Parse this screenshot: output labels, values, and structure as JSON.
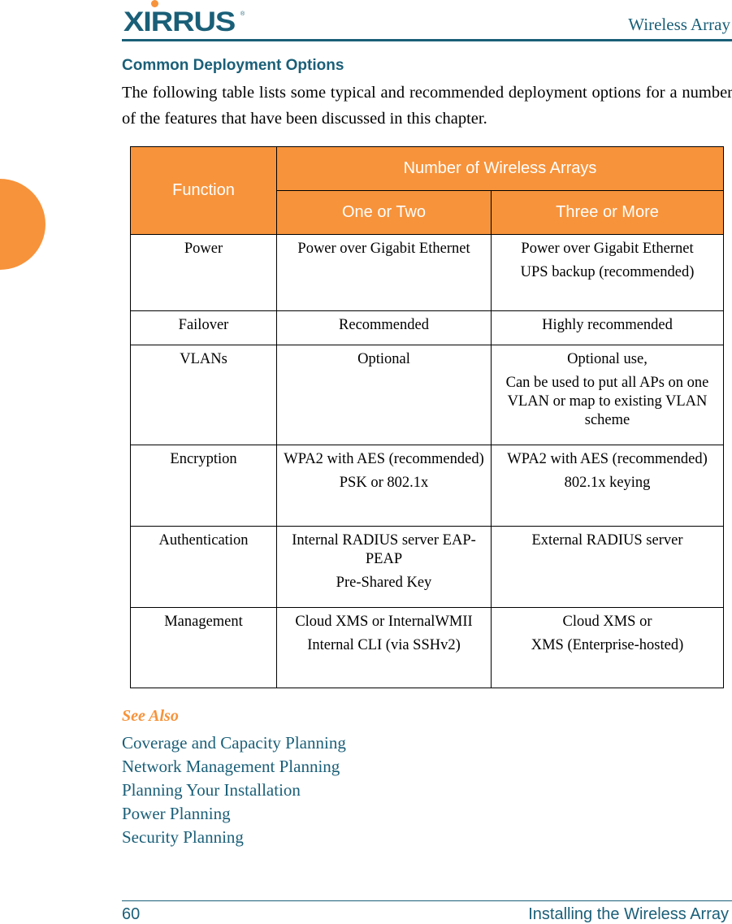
{
  "header": {
    "logo_text": "XIRRUS",
    "logo_reg": "®",
    "title": "Wireless Array"
  },
  "section": {
    "title": "Common Deployment Options",
    "intro": "The following table lists some typical and recommended deployment options for a number of the features that have been discussed in this chapter."
  },
  "table": {
    "header": {
      "function": "Function",
      "group": "Number of Wireless Arrays",
      "col1": "One or Two",
      "col2": "Three or More"
    },
    "rows": [
      {
        "function": "Power",
        "one_or_two": [
          "Power over Gigabit Ethernet"
        ],
        "three_or_more": [
          "Power over Gigabit Ethernet",
          "UPS backup (recommended)"
        ]
      },
      {
        "function": "Failover",
        "one_or_two": [
          "Recommended"
        ],
        "three_or_more": [
          "Highly recommended"
        ]
      },
      {
        "function": "VLANs",
        "one_or_two": [
          "Optional"
        ],
        "three_or_more": [
          "Optional use,",
          "Can be used to put all APs on one VLAN or map to existing VLAN scheme"
        ]
      },
      {
        "function": "Encryption",
        "one_or_two": [
          "WPA2 with AES (recommended)",
          "PSK or 802.1x"
        ],
        "three_or_more": [
          "WPA2 with AES (recommended)",
          "802.1x keying"
        ]
      },
      {
        "function": "Authentication",
        "one_or_two": [
          "Internal RADIUS server EAP-PEAP",
          "Pre-Shared Key"
        ],
        "three_or_more": [
          "External RADIUS server"
        ]
      },
      {
        "function": "Management",
        "one_or_two": [
          "Cloud XMS or InternalWMII",
          "Internal CLI (via SSHv2)"
        ],
        "three_or_more": [
          "Cloud XMS or",
          "XMS (Enterprise-hosted)"
        ]
      }
    ]
  },
  "see_also": {
    "title": "See Also",
    "links": [
      "Coverage and Capacity Planning",
      "Network Management Planning",
      "Planning Your Installation",
      "Power Planning",
      "Security Planning"
    ]
  },
  "footer": {
    "page_number": "60",
    "chapter": "Installing the Wireless Array"
  },
  "colors": {
    "brand_blue": "#1a5f78",
    "accent_orange": "#f7933b"
  }
}
